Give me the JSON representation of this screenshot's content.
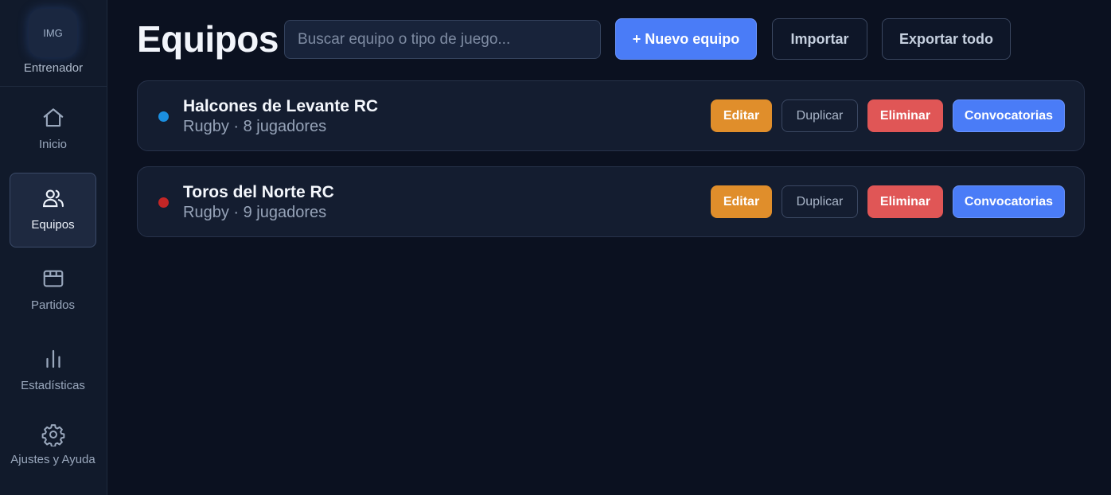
{
  "sidebar": {
    "profile": {
      "avatar_text": "IMG",
      "name": "Entrenador"
    },
    "items": [
      {
        "label": "Inicio",
        "icon": "home-icon"
      },
      {
        "label": "Equipos",
        "icon": "users-icon",
        "active": true
      },
      {
        "label": "Partidos",
        "icon": "calendar-icon"
      },
      {
        "label": "Estadísticas",
        "icon": "bar-chart-icon"
      },
      {
        "label": "Ajustes y Ayuda",
        "icon": "gear-icon"
      }
    ]
  },
  "header": {
    "title": "Equipos",
    "search_placeholder": "Buscar equipo o tipo de juego...",
    "search_value": "",
    "new_team_label": "+ Nuevo equipo",
    "import_label": "Importar",
    "export_label": "Exportar todo"
  },
  "teams": [
    {
      "name": "Halcones de Levante RC",
      "meta": "Rugby · 8 jugadores",
      "dot_color": "#1b8fe0"
    },
    {
      "name": "Toros del Norte RC",
      "meta": "Rugby · 9 jugadores",
      "dot_color": "#c42626"
    }
  ],
  "team_actions": {
    "edit": "Editar",
    "duplicate": "Duplicar",
    "delete": "Eliminar",
    "callups": "Convocatorias"
  },
  "colors": {
    "background": "#0b1120",
    "sidebar": "#111a2b",
    "primary": "#4a7cf7",
    "edit": "#e08e2b",
    "delete": "#e05656"
  }
}
